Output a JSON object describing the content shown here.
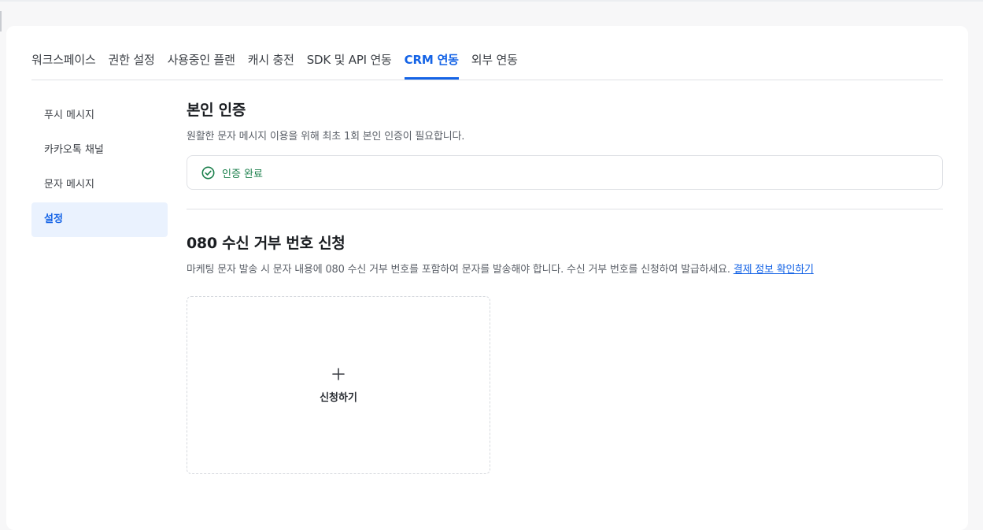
{
  "tabs": [
    {
      "label": "워크스페이스",
      "active": false
    },
    {
      "label": "권한 설정",
      "active": false
    },
    {
      "label": "사용중인 플랜",
      "active": false
    },
    {
      "label": "캐시 충전",
      "active": false
    },
    {
      "label": "SDK 및 API 연동",
      "active": false
    },
    {
      "label": "CRM 연동",
      "active": true
    },
    {
      "label": "외부 연동",
      "active": false
    }
  ],
  "sidebar": {
    "items": [
      {
        "label": "푸시 메시지",
        "active": false
      },
      {
        "label": "카카오톡 채널",
        "active": false
      },
      {
        "label": "문자 메시지",
        "active": false
      },
      {
        "label": "설정",
        "active": true
      }
    ]
  },
  "verification": {
    "title": "본인 인증",
    "description": "원활한 문자 메시지 이용을 위해 최초 1회 본인 인증이 필요합니다.",
    "status_text": "인증 완료",
    "status_icon": "check-circle-icon",
    "status_color": "#1a7f4b"
  },
  "opt_out": {
    "title": "080 수신 거부 번호 신청",
    "description": "마케팅 문자 발송 시 문자 내용에 080 수신 거부 번호를 포함하여 문자를 발송해야 합니다. 수신 거부 번호를 신청하여 발급하세요.",
    "link_text": "결제 정보 확인하기",
    "apply_label": "신청하기",
    "apply_icon": "plus-icon"
  },
  "colors": {
    "accent": "#1463e6",
    "active_bg": "#eaf2fe"
  }
}
